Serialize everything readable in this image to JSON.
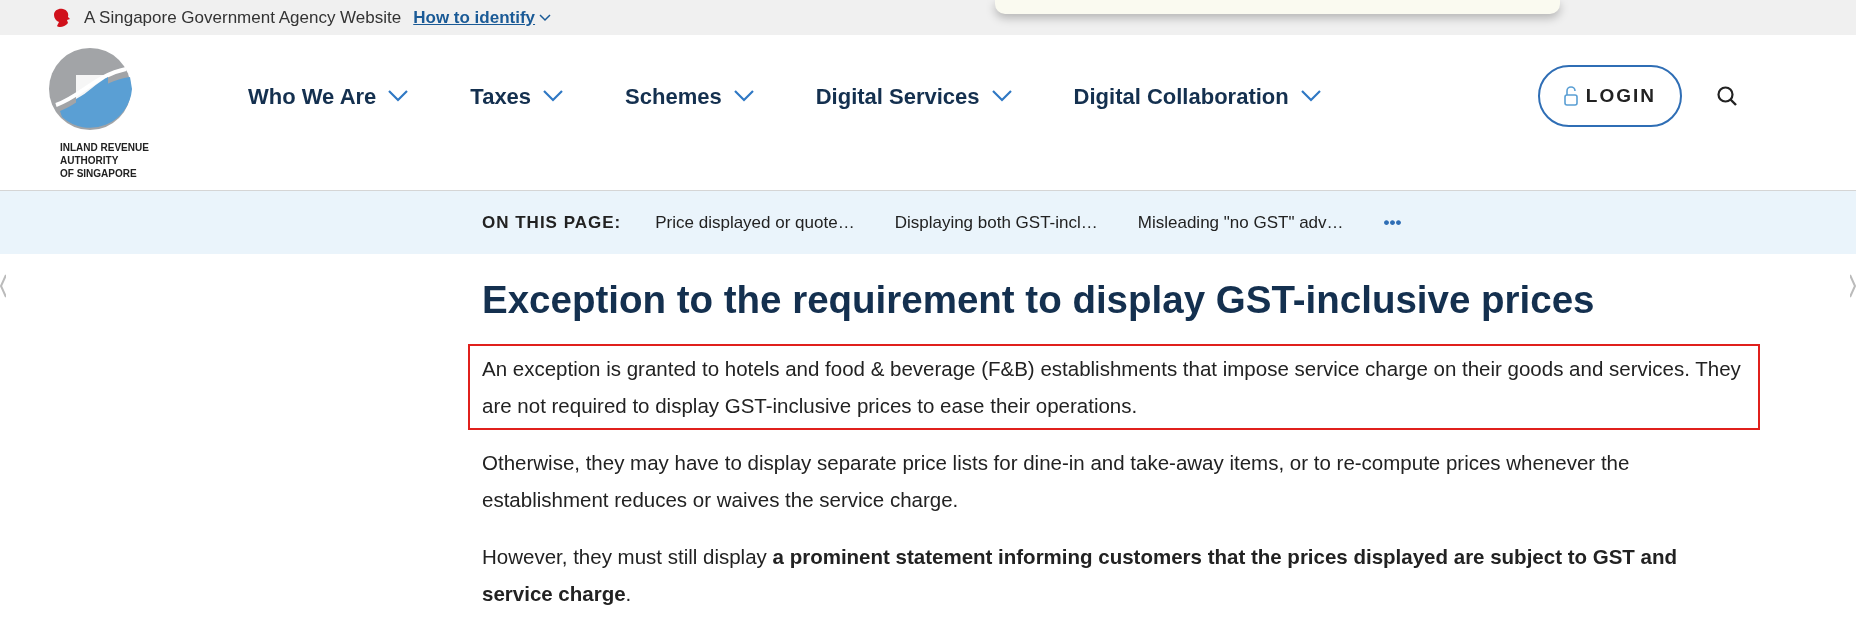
{
  "gov_bar": {
    "text": "A Singapore Government Agency Website",
    "link": "How to identify"
  },
  "header": {
    "logo_lines": [
      "INLAND REVENUE",
      "AUTHORITY",
      "OF SINGAPORE"
    ],
    "nav": [
      {
        "label": "Who We Are"
      },
      {
        "label": "Taxes"
      },
      {
        "label": "Schemes"
      },
      {
        "label": "Digital Services"
      },
      {
        "label": "Digital Collaboration"
      }
    ],
    "login": "LOGIN"
  },
  "on_this_page": {
    "label": "ON THIS PAGE:",
    "links": [
      "Price displayed or quote…",
      "Displaying both GST-incl…",
      "Misleading \"no GST\" adv…"
    ],
    "more": "•••"
  },
  "content": {
    "heading": "Exception to the requirement to display GST-inclusive prices",
    "paragraphs": [
      {
        "text": "An exception is granted to hotels and food & beverage (F&B) establishments that impose service charge on their goods and services. They are not required to display GST-inclusive prices to ease their operations.",
        "highlighted": true
      },
      {
        "text": "Otherwise, they may have to display separate price lists for dine-in and take-away items, or to re-compute prices whenever the establishment reduces or waives the service charge.",
        "highlighted": false
      },
      {
        "text": "However, they must still display **a prominent statement informing customers that the prices displayed are subject to GST and service charge**.",
        "highlighted": false
      }
    ]
  }
}
